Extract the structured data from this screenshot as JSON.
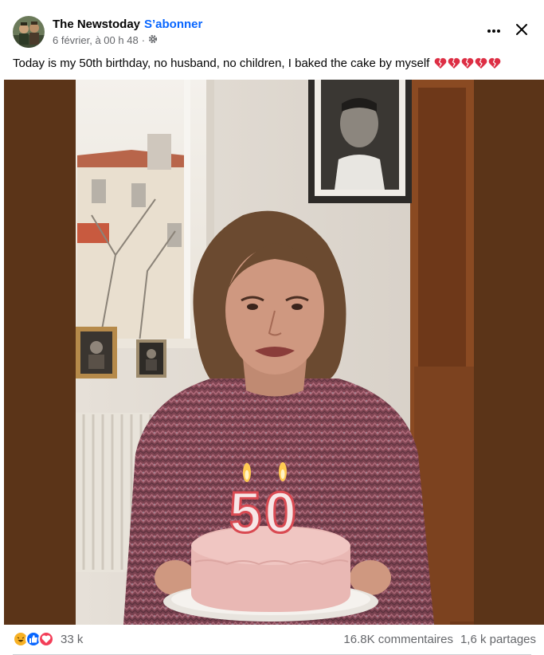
{
  "post": {
    "page_name": "The Newstoday",
    "separator": "·",
    "follow_label": "S’abonner",
    "timestamp": "6 février, à 00 h 48",
    "meta_separator": "·",
    "audience_icon": "gear-icon",
    "caption": "Today is my 50th birthday, no husband, no children, I baked the cake by myself",
    "caption_emoji": "broken-heart-icon x5"
  },
  "header_actions": {
    "more_icon": "more-horizontal-icon",
    "close_icon": "close-icon"
  },
  "photo": {
    "candle_numbers": "50"
  },
  "footer": {
    "reaction_icons": [
      "haha-icon",
      "like-icon",
      "love-icon"
    ],
    "reaction_count": "33 k",
    "comments": "16.8K commentaires",
    "shares": "1,6 k partages"
  },
  "colors": {
    "link_blue": "#0866ff",
    "secondary_text": "#65676b",
    "like_blue": "#0866ff",
    "love_red": "#f33e58",
    "haha_yellow": "#f7b125"
  }
}
